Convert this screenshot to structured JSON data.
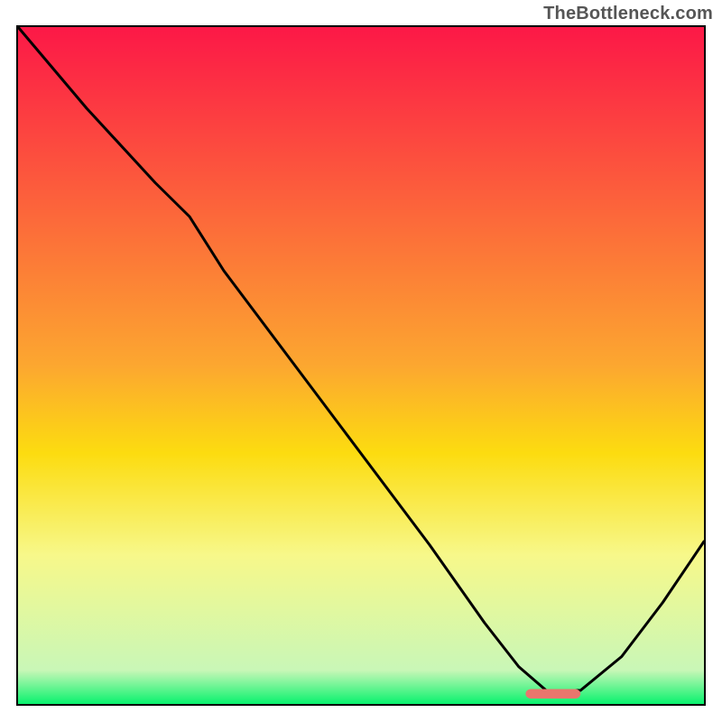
{
  "watermark": "TheBottleneck.com",
  "palette": {
    "top": "#fc1847",
    "mid": "#fcdc10",
    "low": "#f7f88a",
    "bottom": "#09f26e",
    "line": "#000000",
    "marker": "#e9766d",
    "border": "#000000"
  },
  "chart_data": {
    "type": "line",
    "title": "",
    "xlabel": "",
    "ylabel": "",
    "xlim": [
      0,
      1
    ],
    "ylim": [
      0,
      1
    ],
    "legend": false,
    "grid": false,
    "gradient_stops": [
      {
        "pos": 0.0,
        "color": "#fc1847"
      },
      {
        "pos": 0.5,
        "color": "#fca730"
      },
      {
        "pos": 0.63,
        "color": "#fcdc10"
      },
      {
        "pos": 0.78,
        "color": "#f7f88a"
      },
      {
        "pos": 0.95,
        "color": "#c9f7b7"
      },
      {
        "pos": 1.0,
        "color": "#09f26e"
      }
    ],
    "series": [
      {
        "name": "bottleneck-curve",
        "x": [
          0.0,
          0.1,
          0.2,
          0.25,
          0.3,
          0.4,
          0.5,
          0.6,
          0.68,
          0.73,
          0.77,
          0.82,
          0.88,
          0.94,
          1.0
        ],
        "y": [
          1.0,
          0.88,
          0.77,
          0.72,
          0.64,
          0.505,
          0.37,
          0.235,
          0.12,
          0.055,
          0.02,
          0.02,
          0.07,
          0.15,
          0.24
        ]
      }
    ],
    "marker": {
      "name": "optimum-marker",
      "x_start": 0.74,
      "x_end": 0.82,
      "y": 0.015,
      "color": "#e9766d",
      "thickness": 14
    }
  }
}
